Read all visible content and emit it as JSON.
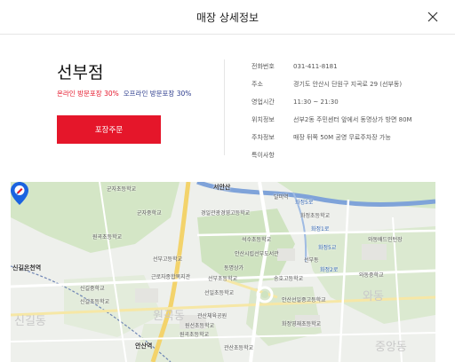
{
  "header": {
    "title": "매장 상세정보"
  },
  "store": {
    "name": "선부점",
    "online_discount": "온라인 방문포장 30%",
    "offline_discount": "오프라인 방문포장 30%",
    "order_button": "포장주문"
  },
  "info": [
    {
      "label": "전화번호",
      "value": "031-411-8181"
    },
    {
      "label": "주소",
      "value": "경기도 안산시 단원구 지곡로 29 (선부동)"
    },
    {
      "label": "영업시간",
      "value": "11:30 ~ 21:30"
    },
    {
      "label": "위치정보",
      "value": "선부2동 주민센터 앞에서 동명상가 방면 80M"
    },
    {
      "label": "주차정보",
      "value": "매장 뒤쪽 50M 공영 무료주차장 가능"
    },
    {
      "label": "특이사항",
      "value": ""
    }
  ],
  "map": {
    "labels": {
      "l1": "군자초등학교",
      "l2": "군자중학교",
      "l3": "서안산",
      "l4": "달미역",
      "l5": "경일관광경영고등학교",
      "l6": "화정5로",
      "l7": "화정초등학교",
      "l8": "와동배드민턴장",
      "l9": "신길온천역",
      "l10": "원곡초등학교",
      "l11": "선부고등학교",
      "l12": "석수초등학교",
      "l13": "화정5교",
      "l14": "선부동",
      "l15": "와동중학교",
      "l16": "신길중학교",
      "l17": "신길초등학교",
      "l18": "근로자종합복지관",
      "l19": "안산시립선부도서관",
      "l20": "송호고등학교",
      "l21": "선일초등학교",
      "l22": "선부초등학교",
      "l23": "원곡동",
      "l24": "신길동",
      "l25": "안산선일중고등학교",
      "l26": "관산체육공원",
      "l27": "화정영재초등학교",
      "l28": "원곡초등학교",
      "l29": "안산역",
      "l30": "관산초등학교",
      "l31": "와동",
      "l32": "중앙동",
      "l33": "동명상가",
      "l34": "화정1로",
      "l35": "원선초등학교",
      "l36": "화정2로"
    }
  },
  "colors": {
    "accent": "#e5162a",
    "offline": "#2a3a8c"
  }
}
